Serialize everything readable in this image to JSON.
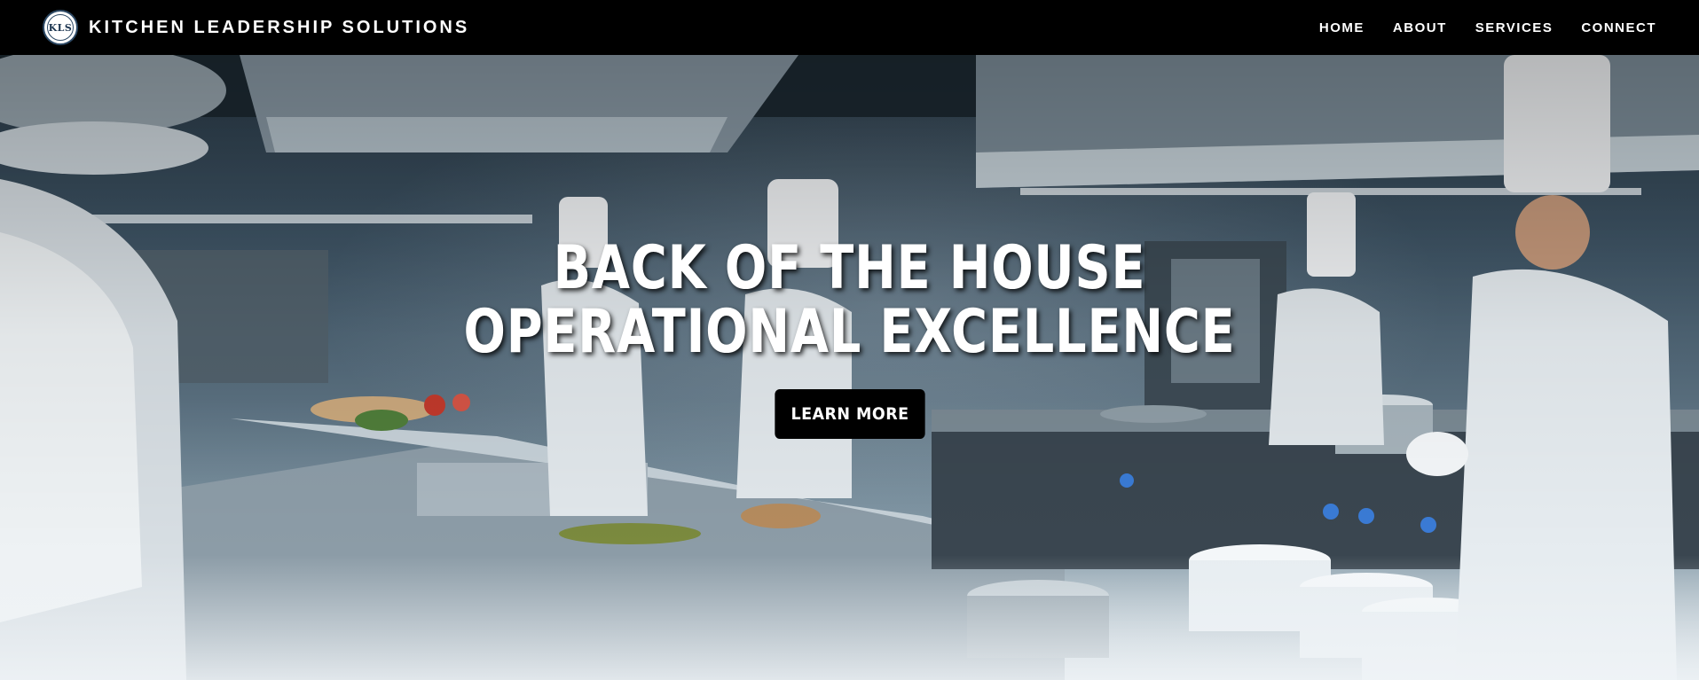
{
  "header": {
    "logo_text": "KLS",
    "brand_name": "KITCHEN LEADERSHIP SOLUTIONS",
    "nav": [
      {
        "label": "HOME"
      },
      {
        "label": "ABOUT"
      },
      {
        "label": "SERVICES"
      },
      {
        "label": "CONNECT"
      }
    ]
  },
  "hero": {
    "title_line1": "BACK OF THE HOUSE",
    "title_line2": "OPERATIONAL EXCELLENCE",
    "cta_label": "LEARN MORE",
    "background_image": "commercial-kitchen-photo"
  },
  "colors": {
    "header_bg": "#000000",
    "header_text": "#ffffff",
    "cta_bg": "#000000",
    "cta_text": "#ffffff"
  }
}
